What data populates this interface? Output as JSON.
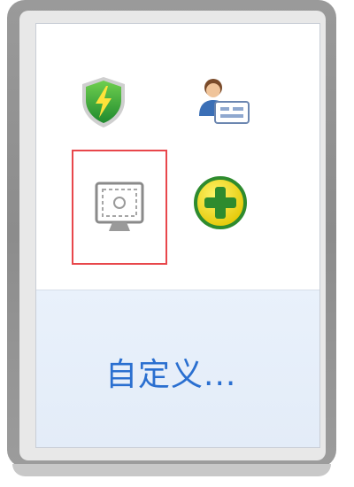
{
  "tray": {
    "icons": [
      {
        "name": "security-shield-icon",
        "color": "#3aa83a",
        "accent": "#ffd400"
      },
      {
        "name": "user-contact-icon"
      },
      {
        "name": "screen-capture-icon",
        "selected": true,
        "highlight_color": "#e8474b"
      },
      {
        "name": "add-plus-icon",
        "color": "#f0d800",
        "accent": "#2e8b2e"
      }
    ]
  },
  "footer": {
    "customize_label": "自定义..."
  }
}
